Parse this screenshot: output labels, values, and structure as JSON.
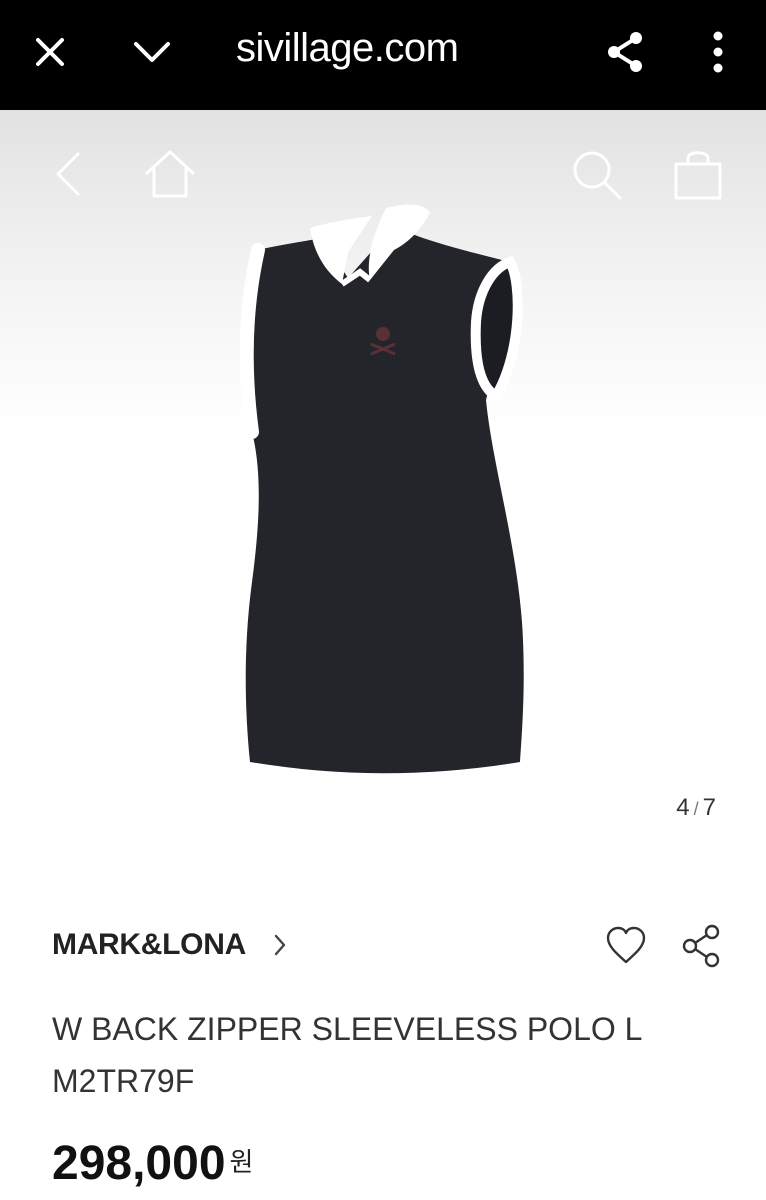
{
  "browser": {
    "url": "sivillage.com",
    "close_icon": "close-icon",
    "chevron_icon": "chevron-down-icon",
    "share_icon": "share-icon",
    "more_icon": "more-vertical-icon"
  },
  "site_nav": {
    "back_icon": "back-arrow-icon",
    "home_icon": "home-icon",
    "search_icon": "search-icon",
    "bag_icon": "shopping-bag-icon"
  },
  "gallery": {
    "current": "4",
    "separator": "/",
    "total": "7",
    "image": "black sleeveless polo with white collar and trim"
  },
  "product": {
    "brand": "MARK&LONA",
    "name_line1": "W BACK ZIPPER SLEEVELESS POLO L",
    "name_line2": "M2TR79F",
    "price": "298,000",
    "currency": "원"
  },
  "colors": {
    "topbar": "#000000",
    "shirt": "#23252b",
    "trim": "#ffffff"
  }
}
